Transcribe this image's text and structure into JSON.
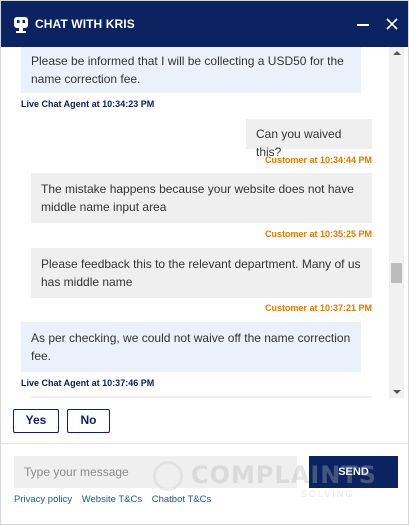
{
  "header": {
    "title": "CHAT WITH KRIS"
  },
  "messages": [
    {
      "sender": "agent",
      "text": "Please be informed that I will be collecting a USD50 for the name correction fee.",
      "timestamp": "Live Chat Agent at 10:34:23 PM"
    },
    {
      "sender": "customer",
      "text": "Can you waived this?",
      "timestamp": "Customer at 10:34:44 PM"
    },
    {
      "sender": "customer",
      "text": "The mistake happens because your website does not have middle name input area",
      "timestamp": "Customer at 10:35:25 PM"
    },
    {
      "sender": "customer",
      "text": "Please feedback this to the relevant department. Many of us has middle name",
      "timestamp": "Customer at 10:37:21 PM"
    },
    {
      "sender": "agent",
      "text": "As per checking, we could not waive off the name correction fee.",
      "timestamp": "Live Chat Agent at 10:37:46 PM"
    }
  ],
  "quick_replies": {
    "yes": "Yes",
    "no": "No"
  },
  "composer": {
    "placeholder": "Type your message",
    "send_label": "SEND"
  },
  "footer": {
    "privacy": "Privacy policy",
    "website_tcs": "Website T&Cs",
    "chatbot_tcs": "Chatbot T&Cs"
  },
  "watermark": {
    "text": "COMPLAINTS",
    "sub": "SOLVING"
  },
  "colors": {
    "brand_navy": "#0c2361",
    "customer_timestamp": "#e07b00",
    "agent_bubble": "#eaf1fb",
    "customer_bubble": "#efefef",
    "link": "#1a55b5"
  }
}
